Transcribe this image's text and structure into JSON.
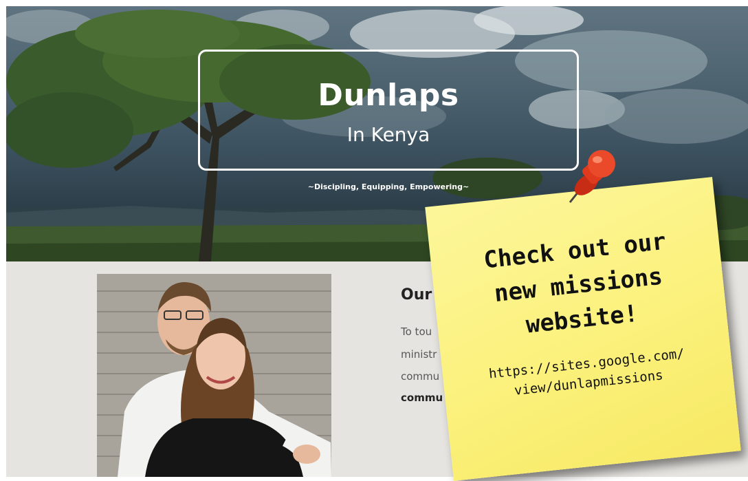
{
  "hero": {
    "title": "Dunlaps",
    "subtitle": "In Kenya",
    "tagline": "~Discipling, Equipping, Empowering~"
  },
  "section": {
    "heading": "Our",
    "lines": [
      "To tou",
      "ministr",
      "commu",
      "commu"
    ]
  },
  "note": {
    "line1": "Check out our",
    "line2": "new missions",
    "line3": "website!",
    "url1": "https://sites.google.com/",
    "url2": "view/dunlapmissions"
  },
  "colors": {
    "note_yellow": "#fbf17c",
    "pin_red": "#e03a1e",
    "content_bg": "#e6e4e0"
  }
}
